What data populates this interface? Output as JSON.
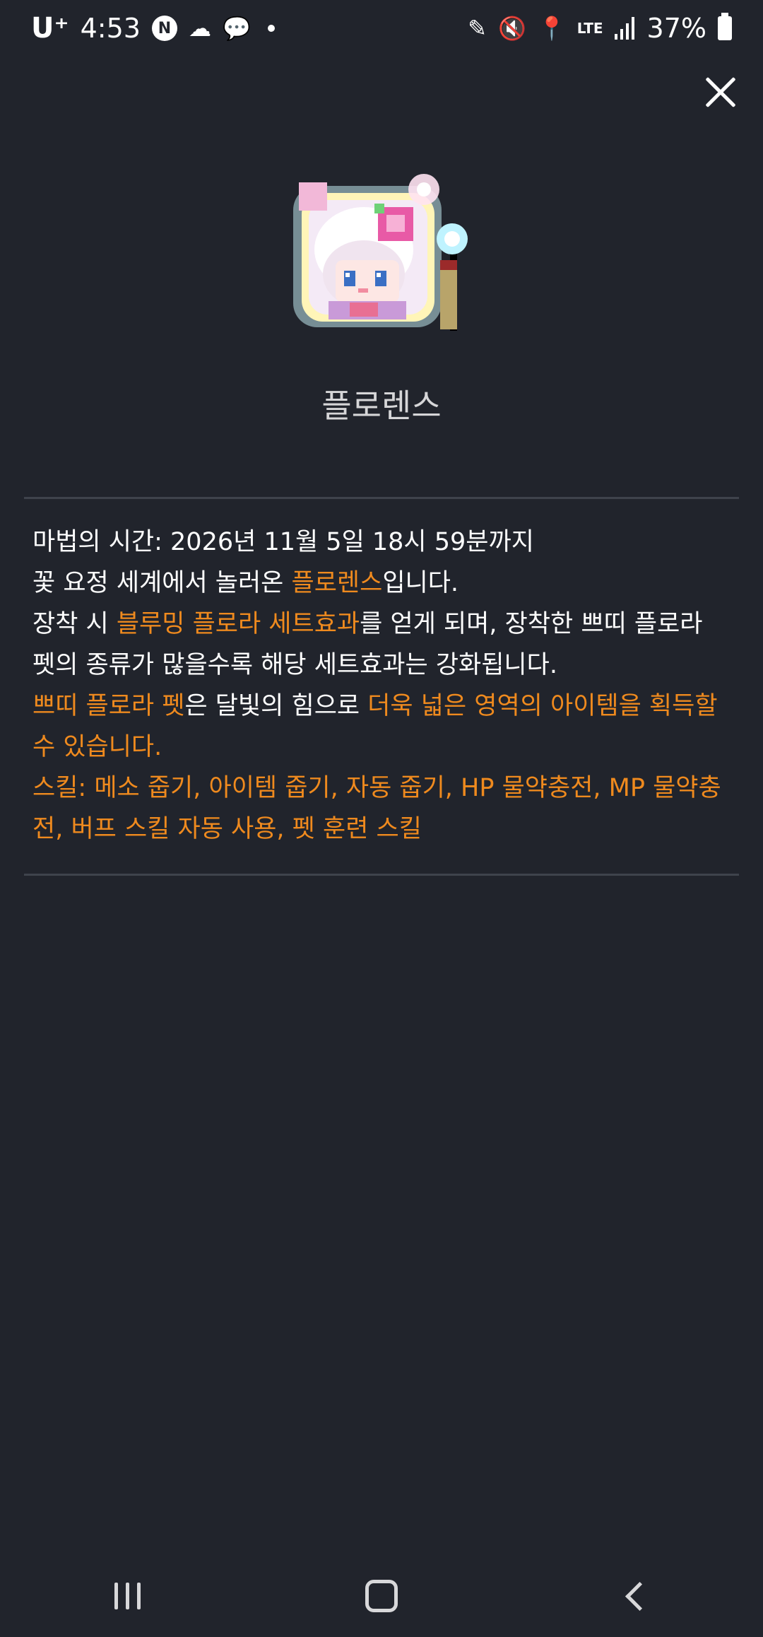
{
  "status_bar": {
    "carrier": "U⁺",
    "time": "4:53",
    "notif_n": "N",
    "signal_tech": "LTE",
    "battery_percent": "37%"
  },
  "item": {
    "name": "플로렌스",
    "description": {
      "line1": "마법의 시간: 2026년 11월 5일 18시 59분까지",
      "line2_a": "꽃 요정 세계에서 놀러온 ",
      "line2_hl": "플로렌스",
      "line2_b": "입니다.",
      "line3_a": "장착 시 ",
      "line3_hl": "블루밍 플로라 세트효과",
      "line3_b": "를 얻게 되며, 장착한 쁘띠 플로라 펫의 종류가 많을수록 해당 세트효과는 강화됩니다.",
      "line4_hl1": "쁘띠 플로라 펫",
      "line4_a": "은 달빛의 힘으로 ",
      "line4_hl2": "더욱 넓은 영역의 아이템을 획득할 수 있습니다.",
      "line5": "스킬: 메소 줍기, 아이템 줍기, 자동 줍기, HP 물약충전, MP 물약충전, 버프 스킬 자동 사용, 펫 훈련 스킬"
    }
  },
  "colors": {
    "background": "#21242c",
    "highlight": "#ef8a1e",
    "divider": "#3f434c"
  }
}
